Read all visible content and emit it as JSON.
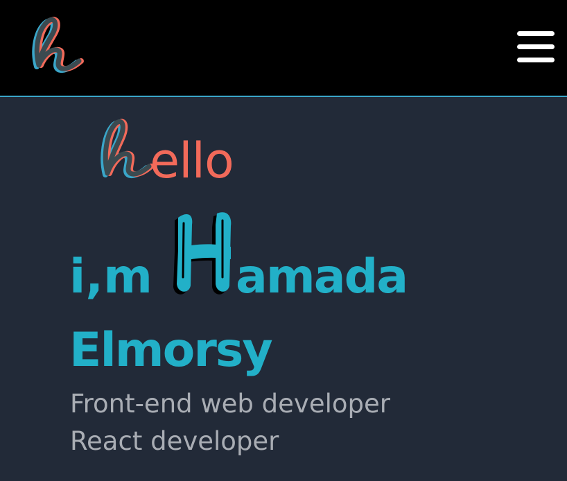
{
  "navbar": {
    "logo_icon": "h-logo-icon",
    "menu_icon": "hamburger-menu-icon"
  },
  "hero": {
    "greeting_initial_icon": "h-letter-icon",
    "greeting_rest": "ello",
    "intro_prefix": "i,m ",
    "name_initial_icon": "H-letter-icon",
    "name_rest": "amada",
    "surname": "Elmorsy",
    "roles": [
      "Front-end web developer",
      "React developer"
    ]
  },
  "colors": {
    "background": "#222a38",
    "navbar": "#000000",
    "accent_cyan": "#22b0c8",
    "accent_coral": "#f26a5a",
    "muted_text": "#a9adb4"
  }
}
